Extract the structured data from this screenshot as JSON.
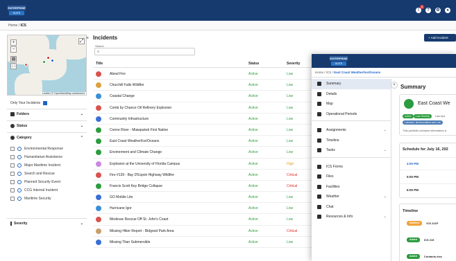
{
  "app": {
    "logo_top": "ENTERPRISE",
    "logo_bottom": "SUITE",
    "notif_count": "1"
  },
  "breadcrumb": {
    "home": "Home",
    "sep": "/",
    "current": "ICS"
  },
  "map": {
    "attribution": "Leaflet | © OpenStreetMap contributors",
    "zoom_in": "+",
    "zoom_out": "−"
  },
  "filters": {
    "only_your": "Only Your Incidents",
    "folders": "Folders",
    "status": "Status",
    "category": "Category",
    "severity": "Severity",
    "categories": [
      "Environmental Response",
      "Humanitarian Assistance",
      "Major Maritime Incident",
      "Search and Rescue",
      "Planned Security Event",
      "CCG Internal Incident",
      "Maritime Security"
    ]
  },
  "incidents": {
    "title": "Incidents",
    "search_label": "Search",
    "add_button": "+ Add Incident",
    "columns": {
      "title": "Title",
      "status": "Status",
      "severity": "Severity"
    },
    "rows": [
      {
        "title": "Abeal Fire",
        "status": "Active",
        "severity": "Low",
        "color": "#d9534f"
      },
      {
        "title": "Churchill Falls Wildfire",
        "status": "Active",
        "severity": "Low",
        "color": "#d9a23f"
      },
      {
        "title": "Coastal Change",
        "status": "Active",
        "severity": "Low",
        "color": "#3a8fd6"
      },
      {
        "title": "Comb by Chance Oil Refinery Explosion",
        "status": "Active",
        "severity": "Low",
        "color": "#d9534f"
      },
      {
        "title": "Community Infrastructure",
        "status": "Active",
        "severity": "Low",
        "color": "#3a6fd6"
      },
      {
        "title": "Conne River - Miawpukek First Nation",
        "status": "Active",
        "severity": "Low",
        "color": "#2b9c3f"
      },
      {
        "title": "East Coast Weather/Ice/Oceans",
        "status": "Active",
        "severity": "Low",
        "color": "#2b9c3f"
      },
      {
        "title": "Environment and Climate Change",
        "status": "Active",
        "severity": "Low",
        "color": "#2b9c3f"
      },
      {
        "title": "Explosion at the University of Florida Campus",
        "status": "Active",
        "severity": "High",
        "color": "#c98adf"
      },
      {
        "title": "Fire #139 - Bay D'Espoir Highway Wildfire",
        "status": "Active",
        "severity": "Critical",
        "color": "#d9534f"
      },
      {
        "title": "Francis Scott Key Bridge Collapse",
        "status": "Active",
        "severity": "Critical",
        "color": "#2b9c3f"
      },
      {
        "title": "GO Mobile Lite",
        "status": "Active",
        "severity": "Low",
        "color": "#3a6fd6"
      },
      {
        "title": "Hurricane Igor",
        "status": "Active",
        "severity": "Low",
        "color": "#3a8fd6"
      },
      {
        "title": "Medevac Rescue Off St. John's Coast",
        "status": "Active",
        "severity": "Low",
        "color": "#d9534f"
      },
      {
        "title": "Missing Hiker Report - Bidgood Park Area",
        "status": "Active",
        "severity": "Critical",
        "color": "#c9a06a"
      },
      {
        "title": "Missing Titan Submersible",
        "status": "Active",
        "severity": "Low",
        "color": "#3a6fd6"
      }
    ]
  },
  "detail": {
    "breadcrumb": {
      "home": "Home",
      "ics": "ICS",
      "current": "East Coast Weather/Ice/Oceans"
    },
    "nav": [
      {
        "label": "Summary",
        "active": true
      },
      {
        "label": "Details"
      },
      {
        "label": "Map"
      },
      {
        "label": "Operational Periods"
      },
      {
        "label": "Assignments",
        "chevron": true
      },
      {
        "label": "Timeline"
      },
      {
        "label": "Tasks",
        "chevron": true
      },
      {
        "label": "ICS Forms"
      },
      {
        "label": "Files"
      },
      {
        "label": "Facilities"
      },
      {
        "label": "Weather",
        "chevron": true
      },
      {
        "label": "Chat"
      },
      {
        "label": "Resources & Info",
        "chevron": true
      }
    ],
    "summary_title": "Summary",
    "card_title": "East Coast We",
    "pills": {
      "active": "Active",
      "severity": "Low Severity",
      "updated": "Last Upd"
    },
    "region": "Labrador, Newfoundland and Lab",
    "description": "This portfolio contains information a",
    "schedule": "Schedule for July 16, 202",
    "times": [
      "4:00 PM",
      "5:00 PM",
      "6:00 PM"
    ],
    "timeline_title": "Timeline",
    "timeline": [
      {
        "tag": "Modified",
        "text": "ICS 211P",
        "color": "#f0a23b"
      },
      {
        "tag": "Added",
        "text": "ICS 215",
        "color": "#2b9c3f"
      },
      {
        "tag": "Added",
        "text": "Contacts.xlsx",
        "color": "#2b9c3f"
      }
    ]
  }
}
